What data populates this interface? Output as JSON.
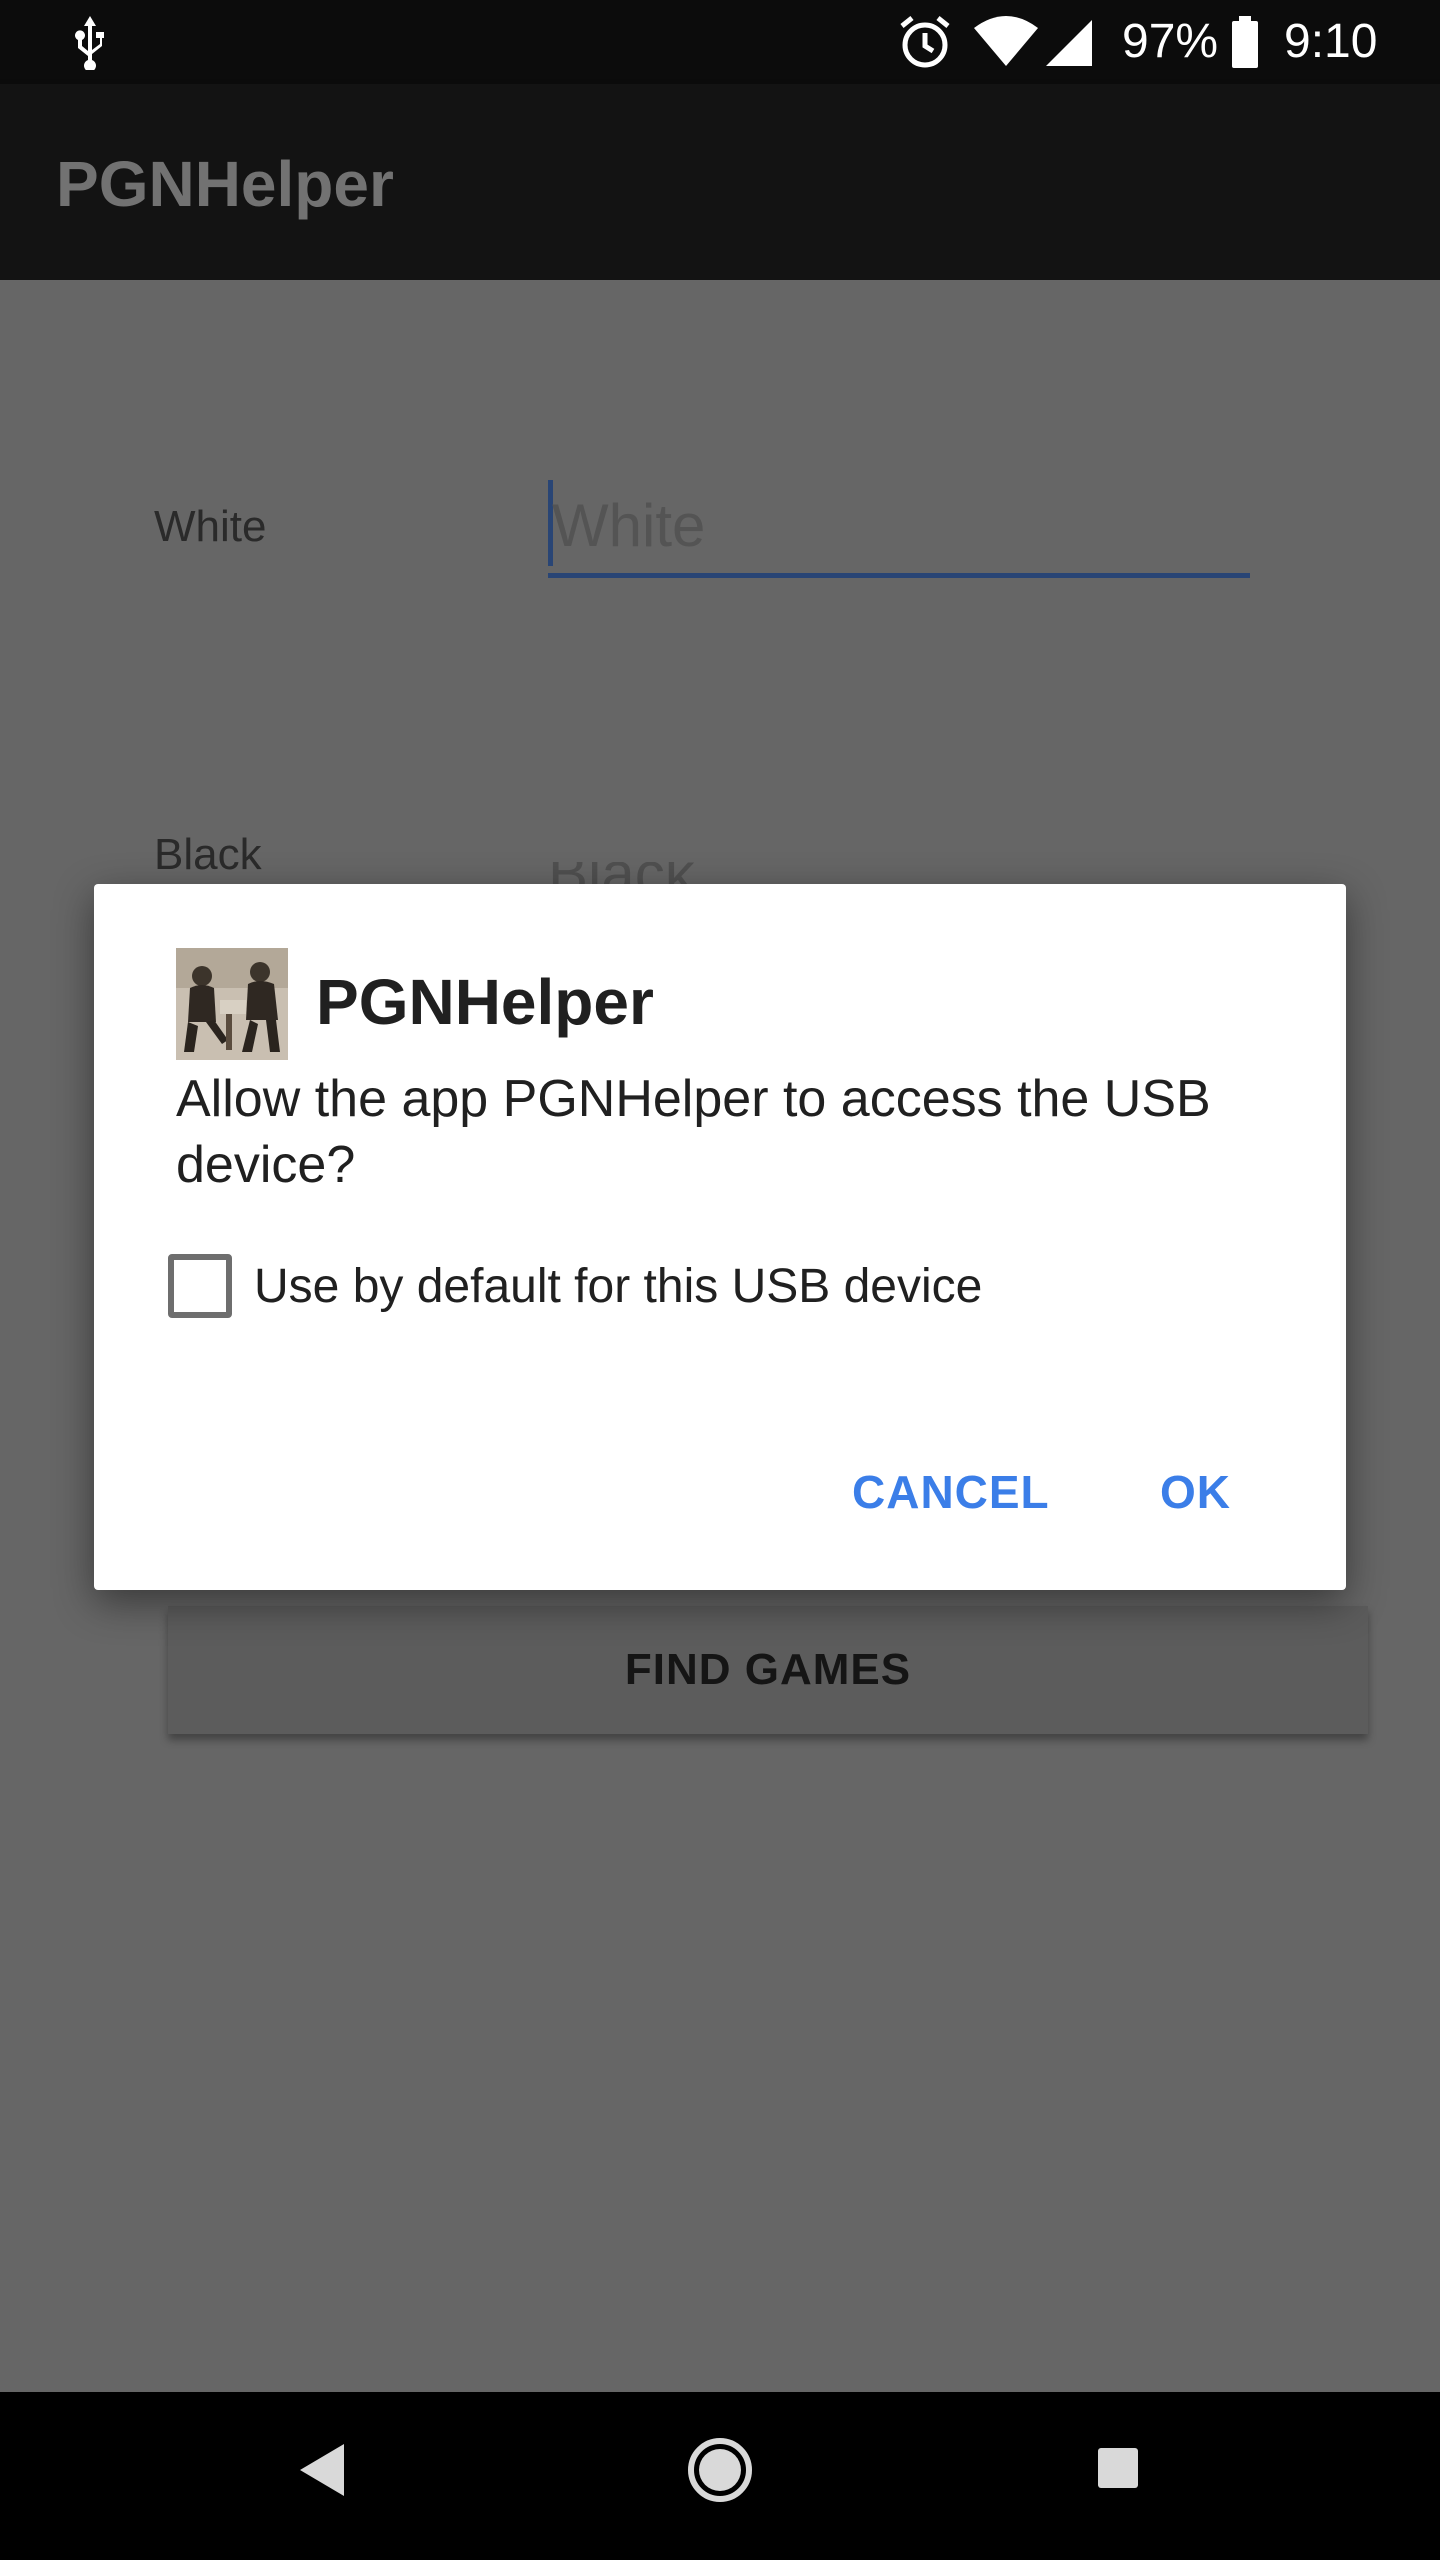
{
  "status_bar": {
    "battery_percent": "97%",
    "time": "9:10",
    "icons": [
      "usb-icon",
      "alarm-icon",
      "wifi-icon",
      "cell-signal-icon",
      "battery-icon"
    ]
  },
  "app_bar": {
    "title": "PGNHelper"
  },
  "form": {
    "white_label": "White",
    "white_placeholder": "White",
    "black_label": "Black",
    "black_partial_value": "Black",
    "find_games_label": "FIND GAMES"
  },
  "dialog": {
    "title": "PGNHelper",
    "icon": "app-icon-chess-players",
    "message": "Allow the app PGNHelper to access the USB device?",
    "checkbox_label": "Use by default for this USB device",
    "checkbox_checked": false,
    "cancel_label": "CANCEL",
    "ok_label": "OK"
  },
  "nav_bar": {
    "icons": [
      "back-icon",
      "home-icon",
      "recents-icon"
    ]
  },
  "colors": {
    "accent": "#3b7ee8",
    "input_underline": "#294575",
    "scrim": "#666666",
    "status_bar": "#0c0c0c",
    "app_bar": "#131313"
  }
}
